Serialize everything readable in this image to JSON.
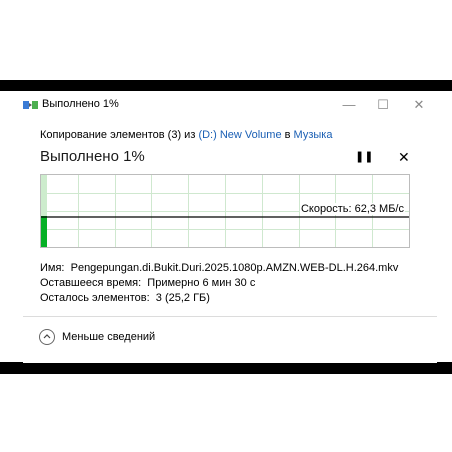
{
  "window": {
    "title": "Выполнено 1%",
    "controls": {
      "minimize": "—",
      "maximize": "☐",
      "close": "✕"
    }
  },
  "operation": {
    "prefix": "Копирование элементов (3) из ",
    "source": "(D:) New Volume",
    "middle": " в ",
    "destination": "Музыка"
  },
  "progress": {
    "title": "Выполнено 1%",
    "percent": 1,
    "pause_icon": "pause-icon",
    "stop_icon": "close-icon",
    "speed_label": "Скорость: 62,3 МБ/с"
  },
  "details": {
    "name_label": "Имя:",
    "name_value": "Pengepungan.di.Bukit.Duri.2025.1080p.AMZN.WEB-DL.H.264.mkv",
    "time_label": "Оставшееся время:",
    "time_value": "Примерно 6 мин 30 с",
    "items_label": "Осталось элементов:",
    "items_value": "3 (25,2 ГБ)"
  },
  "footer": {
    "less_details_label": "Меньше сведений"
  },
  "colors": {
    "accent_green": "#06b025",
    "graph_fill": "#cdeccd",
    "link": "#1a5fb4"
  }
}
